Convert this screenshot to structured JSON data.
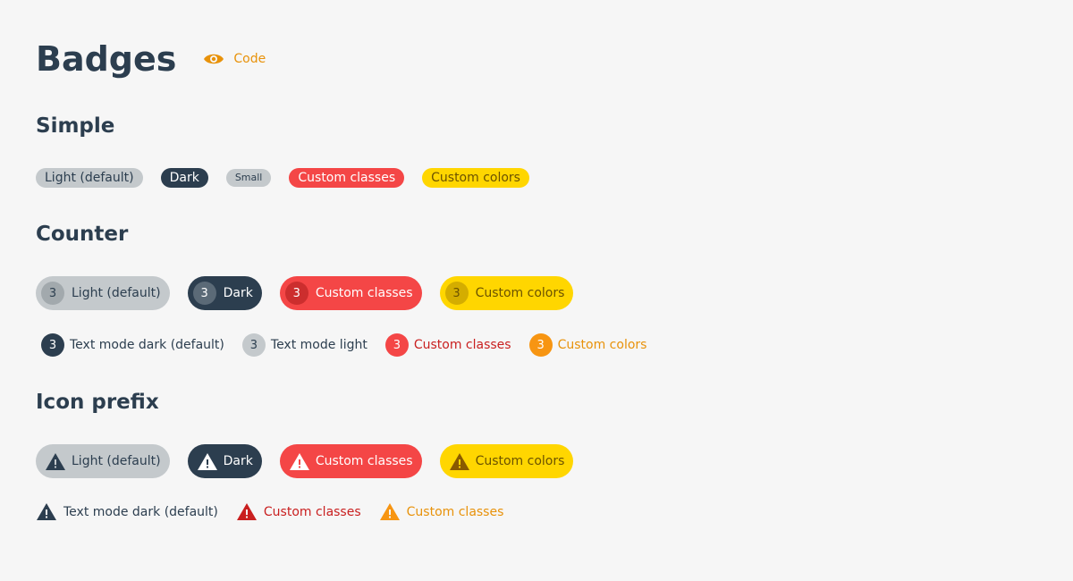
{
  "header": {
    "title": "Badges",
    "code_link": "Code",
    "accent_color": "#e8920a"
  },
  "sections": {
    "simple": {
      "title": "Simple",
      "badges": [
        "Light (default)",
        "Dark",
        "Small",
        "Custom classes",
        "Custom colors"
      ]
    },
    "counter": {
      "title": "Counter",
      "count": "3",
      "pills": [
        "Light (default)",
        "Dark",
        "Custom classes",
        "Custom colors"
      ],
      "text_mode": [
        "Text mode dark (default)",
        "Text mode light",
        "Custom classes",
        "Custom colors"
      ]
    },
    "icon_prefix": {
      "title": "Icon prefix",
      "icon": "warning-icon",
      "pills": [
        "Light (default)",
        "Dark",
        "Custom classes",
        "Custom colors"
      ],
      "text_mode": [
        "Text mode dark (default)",
        "Custom classes",
        "Custom classes"
      ]
    }
  },
  "colors": {
    "dark": "#2c3e4f",
    "light": "#c4c9cc",
    "red": "#f44646",
    "yellow": "#ffd600",
    "orange": "#f79512"
  }
}
